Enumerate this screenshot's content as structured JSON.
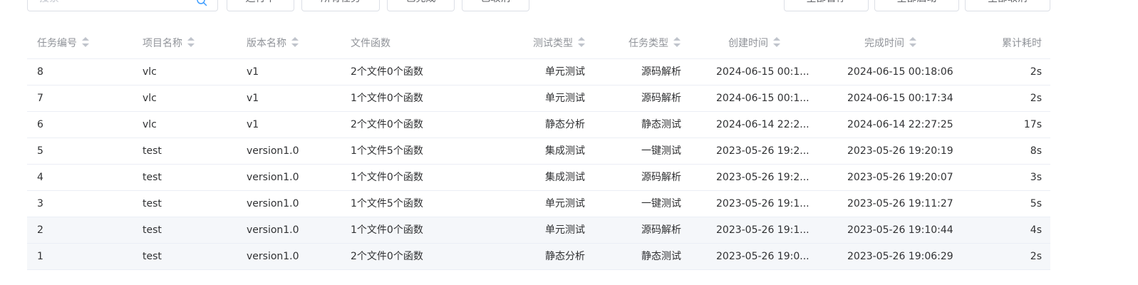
{
  "toolbar": {
    "search_placeholder": "搜索",
    "filters": [
      "运行中",
      "所有任务",
      "已完成",
      "已取消"
    ],
    "actions": [
      "全部暂停",
      "全部启动",
      "全部取消"
    ]
  },
  "table": {
    "headers": {
      "id": "任务编号",
      "project": "项目名称",
      "version": "版本名称",
      "files": "文件函数",
      "test_type": "测试类型",
      "task_type": "任务类型",
      "created": "创建时间",
      "finished": "完成时间",
      "elapsed": "累计耗时"
    },
    "rows": [
      {
        "id": "8",
        "project": "vlc",
        "version": "v1",
        "files": "2个文件0个函数",
        "test_type": "单元测试",
        "task_type": "源码解析",
        "created": "2024-06-15 00:1...",
        "finished": "2024-06-15 00:18:06",
        "elapsed": "2s"
      },
      {
        "id": "7",
        "project": "vlc",
        "version": "v1",
        "files": "1个文件0个函数",
        "test_type": "单元测试",
        "task_type": "源码解析",
        "created": "2024-06-15 00:1...",
        "finished": "2024-06-15 00:17:34",
        "elapsed": "2s"
      },
      {
        "id": "6",
        "project": "vlc",
        "version": "v1",
        "files": "2个文件0个函数",
        "test_type": "静态分析",
        "task_type": "静态测试",
        "created": "2024-06-14 22:2...",
        "finished": "2024-06-14 22:27:25",
        "elapsed": "17s"
      },
      {
        "id": "5",
        "project": "test",
        "version": "version1.0",
        "files": "1个文件5个函数",
        "test_type": "集成测试",
        "task_type": "一键测试",
        "created": "2023-05-26 19:2...",
        "finished": "2023-05-26 19:20:19",
        "elapsed": "8s"
      },
      {
        "id": "4",
        "project": "test",
        "version": "version1.0",
        "files": "1个文件0个函数",
        "test_type": "集成测试",
        "task_type": "源码解析",
        "created": "2023-05-26 19:2...",
        "finished": "2023-05-26 19:20:07",
        "elapsed": "3s"
      },
      {
        "id": "3",
        "project": "test",
        "version": "version1.0",
        "files": "1个文件5个函数",
        "test_type": "单元测试",
        "task_type": "一键测试",
        "created": "2023-05-26 19:1...",
        "finished": "2023-05-26 19:11:27",
        "elapsed": "5s"
      },
      {
        "id": "2",
        "project": "test",
        "version": "version1.0",
        "files": "1个文件0个函数",
        "test_type": "单元测试",
        "task_type": "源码解析",
        "created": "2023-05-26 19:1...",
        "finished": "2023-05-26 19:10:44",
        "elapsed": "4s"
      },
      {
        "id": "1",
        "project": "test",
        "version": "version1.0",
        "files": "2个文件0个函数",
        "test_type": "静态分析",
        "task_type": "静态测试",
        "created": "2023-05-26 19:0...",
        "finished": "2023-05-26 19:06:29",
        "elapsed": "2s"
      }
    ],
    "highlighted_rows": [
      6,
      7
    ]
  },
  "colors": {
    "border": "#ebeef5",
    "header_text": "#909399",
    "body_text": "#303133",
    "row_highlight": "#f5f7fa",
    "accent": "#409eff"
  }
}
